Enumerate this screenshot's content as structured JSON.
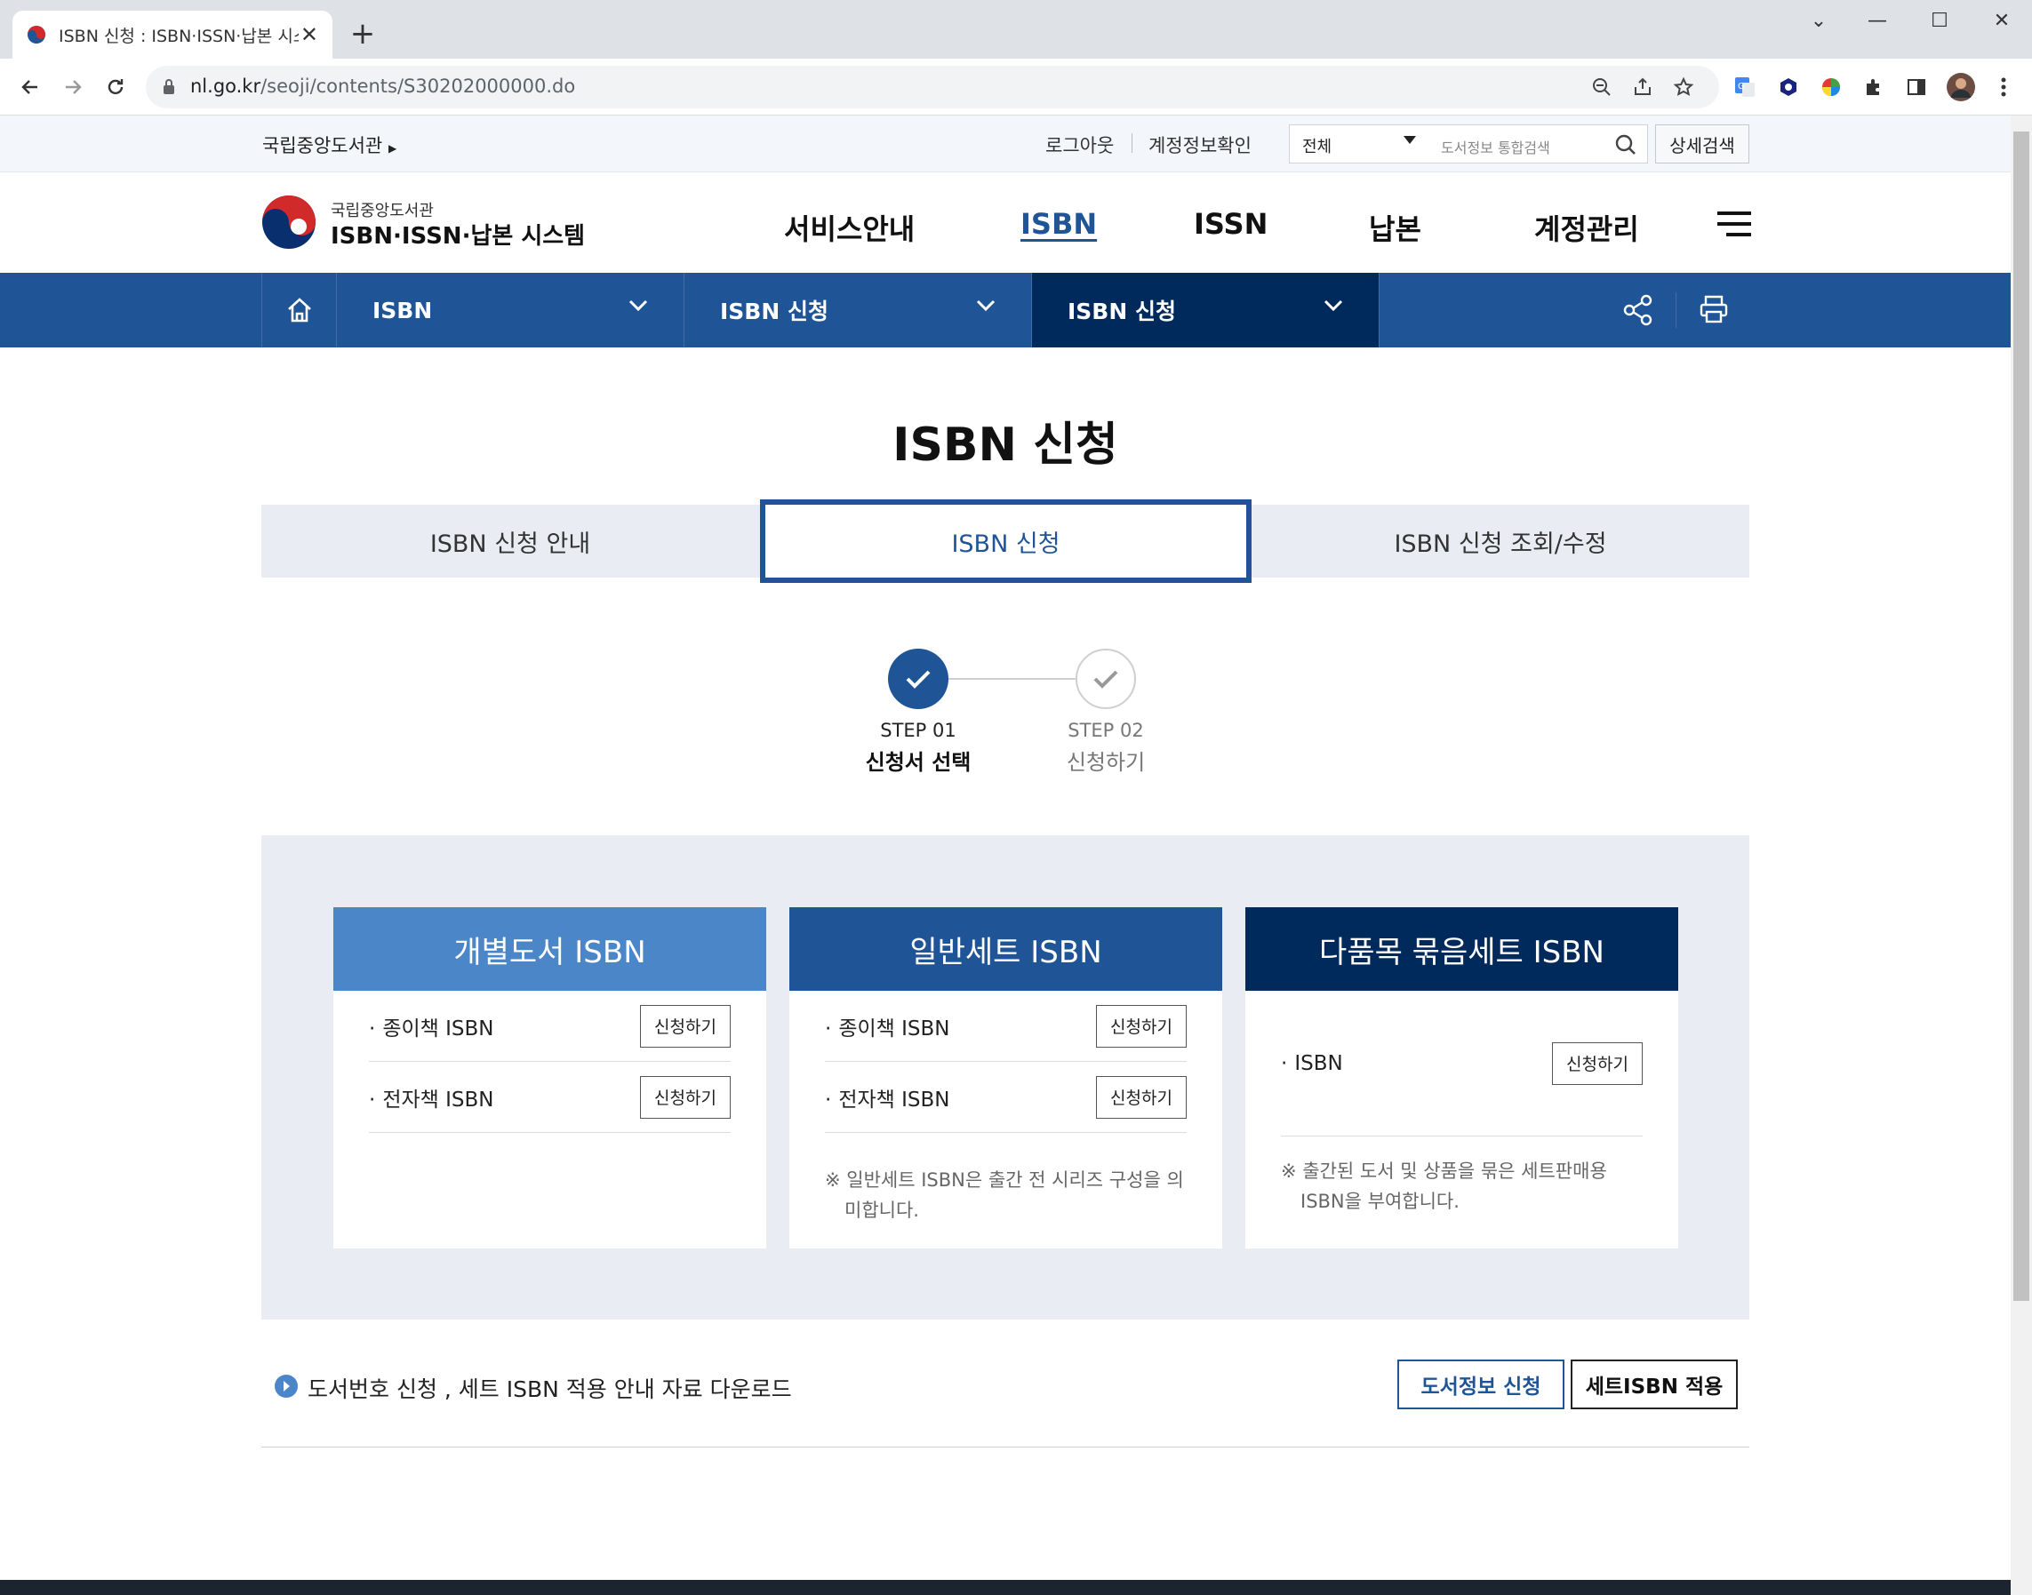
{
  "browser": {
    "tab_title": "ISBN 신청 : ISBN·ISSN·납본 시스",
    "url_host": "nl.go.kr",
    "url_path": "/seoji/contents/S30202000000.do"
  },
  "util": {
    "home_link": "국립중앙도서관",
    "logout": "로그아웃",
    "account_check": "계정정보확인",
    "search_scope": "전체",
    "search_placeholder": "도서정보 통합검색",
    "advanced_search": "상세검색"
  },
  "logo": {
    "line1": "국립중앙도서관",
    "line2": "ISBN·ISSN·납본 시스템"
  },
  "gnb": [
    "서비스안내",
    "ISBN",
    "ISSN",
    "납본",
    "계정관리"
  ],
  "breadcrumb": [
    "ISBN",
    "ISBN 신청",
    "ISBN 신청"
  ],
  "page_title": "ISBN 신청",
  "tabs": [
    "ISBN 신청 안내",
    "ISBN 신청",
    "ISBN 신청 조회/수정"
  ],
  "steps": [
    {
      "num": "STEP 01",
      "label": "신청서 선택"
    },
    {
      "num": "STEP 02",
      "label": "신청하기"
    }
  ],
  "cards": [
    {
      "title": "개별도서 ISBN",
      "rows": [
        "종이책 ISBN",
        "전자책 ISBN"
      ],
      "button": "신청하기"
    },
    {
      "title": "일반세트 ISBN",
      "rows": [
        "종이책 ISBN",
        "전자책 ISBN"
      ],
      "button": "신청하기",
      "note": "※ 일반세트 ISBN은 출간 전 시리즈 구성을 의미합니다."
    },
    {
      "title": "다품목 묶음세트 ISBN",
      "rows": [
        "ISBN"
      ],
      "button": "신청하기",
      "note": "※ 출간된 도서 및 상품을 묶은 세트판매용 ISBN을 부여합니다."
    }
  ],
  "download_text": "도서번호 신청 , 세트 ISBN 적용 안내 자료 다운로드",
  "bottom_buttons": [
    "도서정보 신청",
    "세트ISBN 적용"
  ],
  "colors": {
    "primary": "#1f5596",
    "dark_navy": "#002a5c",
    "light_blue": "#4a86c8",
    "mid_blue": "#1f5596",
    "panel_bg": "#e9edf3"
  }
}
